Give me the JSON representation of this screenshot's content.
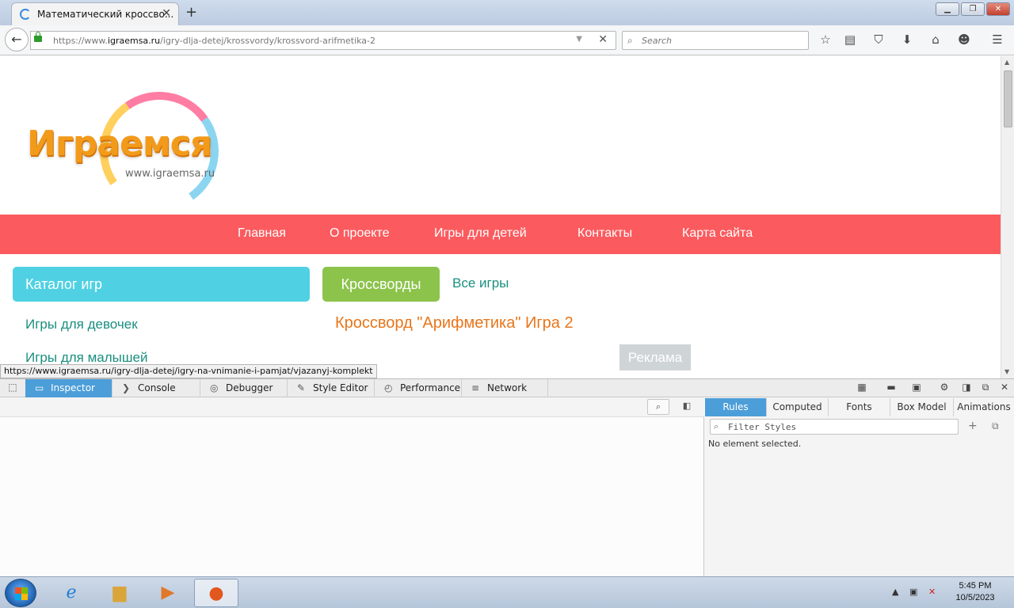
{
  "browser": {
    "tab_title": "Математический кроссво...",
    "new_tab": "+",
    "url_prefix": "https://www.",
    "url_domain": "igraemsa.ru",
    "url_path": "/igry-dlja-detej/krossvordy/krossvord-arifmetika-2",
    "search_placeholder": "Search",
    "status_url": "https://www.igraemsa.ru/igry-dlja-detej/igry-na-vnimanie-i-pamjat/vjazanyj-komplekt"
  },
  "page": {
    "logo_word": "Играемся",
    "logo_site": "www.igraemsa.ru",
    "menu": [
      "Главная",
      "О проекте",
      "Игры для детей",
      "Контакты",
      "Карта сайта"
    ],
    "catalog_label": "Каталог игр",
    "crosswords_label": "Кроссворды",
    "all_games_label": "Все игры",
    "sidebar_links": [
      "Игры для девочек",
      "Игры для малышей"
    ],
    "game_heading": "Кроссворд \"Арифметика\" Игра 2",
    "ad_label": "Реклама"
  },
  "devtools": {
    "tabs": [
      "Inspector",
      "Console",
      "Debugger",
      "Style Editor",
      "Performance",
      "Network"
    ],
    "sidebar_tabs": [
      "Rules",
      "Computed",
      "Fonts",
      "Box Model",
      "Animations"
    ],
    "filter_placeholder": "Filter Styles",
    "no_element": "No element selected."
  },
  "taskbar": {
    "time": "5:45 PM",
    "date": "10/5/2023"
  },
  "colors": {
    "menu_bg": "#fb5b5e",
    "catalog_bg": "#4fd1e3",
    "crosswords_bg": "#8cc34b",
    "link": "#1a8f7e",
    "heading": "#e8751a",
    "devtools_active": "#4c9ed9"
  }
}
